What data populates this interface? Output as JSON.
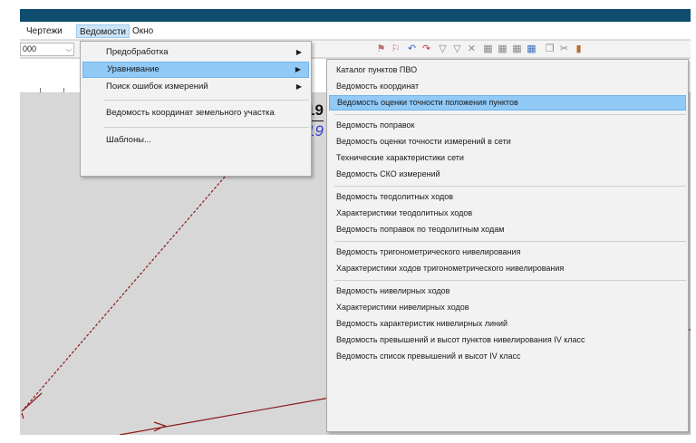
{
  "menubar": {
    "items": [
      {
        "label": "Чертежи"
      },
      {
        "label": "Ведомости"
      },
      {
        "label": "Окно"
      }
    ]
  },
  "toolbar": {
    "scale_value": "000"
  },
  "main_menu": {
    "items": [
      {
        "label": "Предобработка",
        "has_submenu": true
      },
      {
        "label": "Уравнивание",
        "has_submenu": true,
        "highlighted": true
      },
      {
        "label": "Поиск ошибок измерений",
        "has_submenu": true
      },
      {
        "label": "Ведомость координат земельного участка",
        "has_submenu": false
      },
      {
        "label": "Шаблоны...",
        "has_submenu": false
      }
    ]
  },
  "submenu": {
    "items": [
      {
        "label": "Каталог пунктов ПВО"
      },
      {
        "label": "Ведомость координат"
      },
      {
        "label": "Ведомость оценки точности положения пунктов",
        "highlighted": true
      },
      {
        "label": "Ведомость поправок"
      },
      {
        "label": "Ведомость оценки точности измерений в сети"
      },
      {
        "label": "Технические характеристики сети"
      },
      {
        "label": "Ведомость СКО измерений"
      },
      {
        "label": "Ведомость теодолитных ходов"
      },
      {
        "label": "Характеристики теодолитных ходов"
      },
      {
        "label": "Ведомость поправок по теодолитным ходам"
      },
      {
        "label": "Ведомость тригонометрического нивелирования"
      },
      {
        "label": "Характеристики ходов тригонометрического нивелирования"
      },
      {
        "label": "Ведомость нивелирных ходов"
      },
      {
        "label": "Характеристики нивелирных ходов"
      },
      {
        "label": "Ведомость характеристик нивелирных линий"
      },
      {
        "label": "Ведомость превышений и высот пунктов нивелирования IV класс"
      },
      {
        "label": "Ведомость список превышений и высот IV класс"
      }
    ]
  },
  "drawing": {
    "point_label_top": "19",
    "point_label_bottom": "19"
  },
  "colors": {
    "titlebar": "#0f4c6e",
    "highlight": "#91c9f7",
    "line": "#8b1a1a",
    "triangle": "#ffee00",
    "label_blue": "#2f3fd0"
  }
}
